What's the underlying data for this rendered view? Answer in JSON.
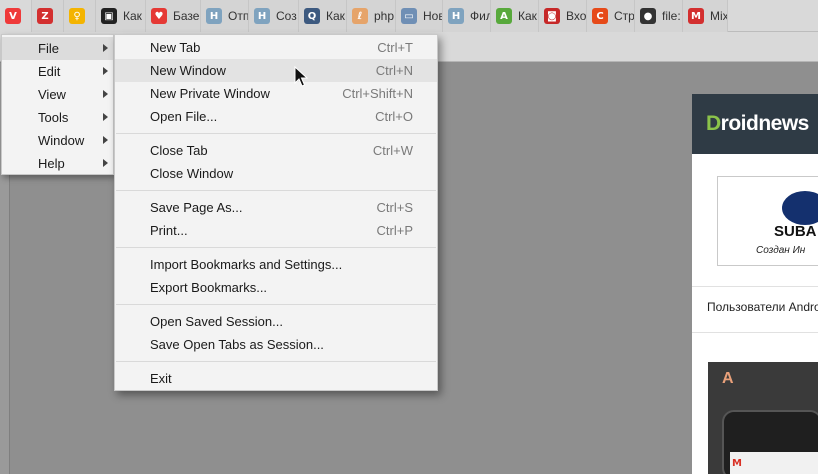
{
  "tabs": [
    {
      "title": "",
      "icon": "vivaldi-icon",
      "color": "#ef3939",
      "glyph": "V"
    },
    {
      "title": "",
      "icon": "z-app-icon",
      "color": "#d32f2f",
      "glyph": "Z"
    },
    {
      "title": "",
      "icon": "bulb-icon",
      "color": "#f4b400",
      "glyph": "♀"
    },
    {
      "title": "Как",
      "icon": "site-dark-icon",
      "color": "#222222",
      "glyph": "▣"
    },
    {
      "title": "Базе",
      "icon": "heart-icon",
      "color": "#e53935",
      "glyph": "♥"
    },
    {
      "title": "Отп",
      "icon": "h-site-icon",
      "color": "#7fa3bf",
      "glyph": "H"
    },
    {
      "title": "Соз",
      "icon": "h-site-icon",
      "color": "#7fa3bf",
      "glyph": "H"
    },
    {
      "title": "Как",
      "icon": "q-site-icon",
      "color": "#3d5a80",
      "glyph": "Q"
    },
    {
      "title": "php",
      "icon": "php-icon",
      "color": "#e6a46a",
      "glyph": "ℓ"
    },
    {
      "title": "Нов",
      "icon": "monitor-icon",
      "color": "#6f8fb5",
      "glyph": "▭"
    },
    {
      "title": "Фил",
      "icon": "h-site-icon",
      "color": "#7fa3bf",
      "glyph": "H"
    },
    {
      "title": "Как",
      "icon": "android-icon",
      "color": "#58a93c",
      "glyph": "A"
    },
    {
      "title": "Вхо",
      "icon": "camera-icon",
      "color": "#c62828",
      "glyph": "◙"
    },
    {
      "title": "Стр",
      "icon": "c-site-icon",
      "color": "#e64a19",
      "glyph": "C"
    },
    {
      "title": "file:",
      "icon": "globe-icon",
      "color": "#333333",
      "glyph": "●"
    },
    {
      "title": "Mix",
      "icon": "mix-icon",
      "color": "#d32f2f",
      "glyph": "M"
    }
  ],
  "main_menu": [
    {
      "label": "File",
      "key": "file"
    },
    {
      "label": "Edit",
      "key": "edit"
    },
    {
      "label": "View",
      "key": "view"
    },
    {
      "label": "Tools",
      "key": "tools"
    },
    {
      "label": "Window",
      "key": "window"
    },
    {
      "label": "Help",
      "key": "help"
    }
  ],
  "file_menu": {
    "groups": [
      [
        {
          "label": "New Tab",
          "shortcut": "Ctrl+T"
        },
        {
          "label": "New Window",
          "shortcut": "Ctrl+N"
        },
        {
          "label": "New Private Window",
          "shortcut": "Ctrl+Shift+N"
        },
        {
          "label": "Open File...",
          "shortcut": "Ctrl+O"
        }
      ],
      [
        {
          "label": "Close Tab",
          "shortcut": "Ctrl+W"
        },
        {
          "label": "Close Window",
          "shortcut": ""
        }
      ],
      [
        {
          "label": "Save Page As...",
          "shortcut": "Ctrl+S"
        },
        {
          "label": "Print...",
          "shortcut": "Ctrl+P"
        }
      ],
      [
        {
          "label": "Import Bookmarks and Settings...",
          "shortcut": ""
        },
        {
          "label": "Export Bookmarks...",
          "shortcut": ""
        }
      ],
      [
        {
          "label": "Open Saved Session...",
          "shortcut": ""
        },
        {
          "label": "Save Open Tabs as Session...",
          "shortcut": ""
        }
      ],
      [
        {
          "label": "Exit",
          "shortcut": ""
        }
      ]
    ]
  },
  "page": {
    "site_name_first": "D",
    "site_name_rest": "roidnews",
    "ad_brand": "SUBA",
    "ad_slogan": "Создан Ин",
    "notice_text": "Пользователи Android",
    "badge_text": "A",
    "gmail_glyph": "M"
  },
  "colors": {
    "menu_bg": "#f3f3f3",
    "menu_hover": "#e3e3e3",
    "header_dark": "#2f3b45",
    "accent_green": "#8bc34a"
  }
}
